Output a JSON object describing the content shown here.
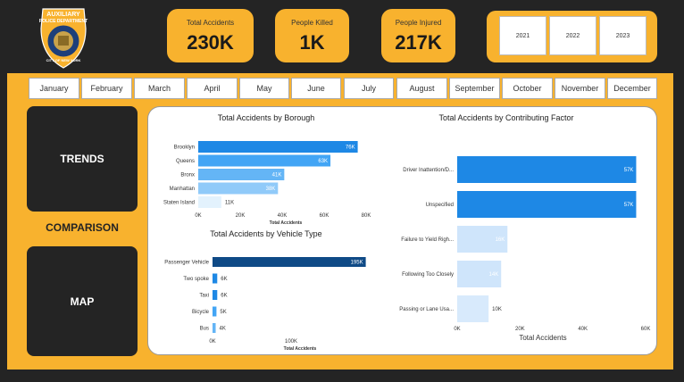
{
  "kpis": [
    {
      "label": "Total Accidents",
      "value": "230K"
    },
    {
      "label": "People Killed",
      "value": "1K"
    },
    {
      "label": "People Injured",
      "value": "217K"
    }
  ],
  "years": [
    "2021",
    "2022",
    "2023"
  ],
  "months": [
    "January",
    "February",
    "March",
    "April",
    "May",
    "June",
    "July",
    "August",
    "September",
    "October",
    "November",
    "December"
  ],
  "nav": {
    "trends": "TRENDS",
    "comparison": "COMPARISON",
    "map": "MAP"
  },
  "logo": {
    "text_top": "AUXILIARY",
    "text_mid": "POLICE DEPARTMENT",
    "text_arc": "CITY OF NEW YORK"
  },
  "colors": {
    "accent": "#f8b22e",
    "dark": "#242424",
    "bar_dark": "#0f4a86",
    "bar_blue": "#1e88e5"
  },
  "chart_data": [
    {
      "type": "bar",
      "orientation": "horizontal",
      "title": "Total Accidents by Borough",
      "xlabel": "Total Accidents",
      "categories": [
        "Brooklyn",
        "Queens",
        "Bronx",
        "Manhattan",
        "Staten Island"
      ],
      "values": [
        76,
        63,
        41,
        38,
        11
      ],
      "value_labels": [
        "76K",
        "63K",
        "41K",
        "38K",
        "11K"
      ],
      "xticks": [
        "0K",
        "20K",
        "40K",
        "60K",
        "80K"
      ],
      "xlim": [
        0,
        80
      ],
      "bar_colors": [
        "#1e88e5",
        "#42a5f5",
        "#64b5f6",
        "#90caf9",
        "#e3f2fd"
      ]
    },
    {
      "type": "bar",
      "orientation": "horizontal",
      "title": "Total Accidents by Vehicle Type",
      "xlabel": "Total Accidents",
      "categories": [
        "Passenger Vehicle",
        "Two spoke",
        "Taxi",
        "Bicycle",
        "Bus"
      ],
      "values": [
        195,
        6,
        6,
        5,
        4
      ],
      "value_labels": [
        "195K",
        "6K",
        "6K",
        "5K",
        "4K"
      ],
      "xticks": [
        "0K",
        "100K"
      ],
      "xlim": [
        0,
        200
      ],
      "bar_colors": [
        "#0f4a86",
        "#1e88e5",
        "#1e88e5",
        "#42a5f5",
        "#64b5f6"
      ]
    },
    {
      "type": "bar",
      "orientation": "horizontal",
      "title": "Total Accidents by Contributing Factor",
      "xlabel": "Total Accidents",
      "categories": [
        "Driver Inattention/D...",
        "Unspecified",
        "Failure to Yield Righ...",
        "Following Too Closely",
        "Passing or Lane Usa..."
      ],
      "values": [
        57,
        57,
        16,
        14,
        10
      ],
      "value_labels": [
        "57K",
        "57K",
        "16K",
        "14K",
        "10K"
      ],
      "xticks": [
        "0K",
        "20K",
        "40K",
        "60K"
      ],
      "xlim": [
        0,
        60
      ],
      "bar_colors": [
        "#1e88e5",
        "#1e88e5",
        "#cfe5fb",
        "#cfe5fb",
        "#d8eafc"
      ]
    }
  ]
}
